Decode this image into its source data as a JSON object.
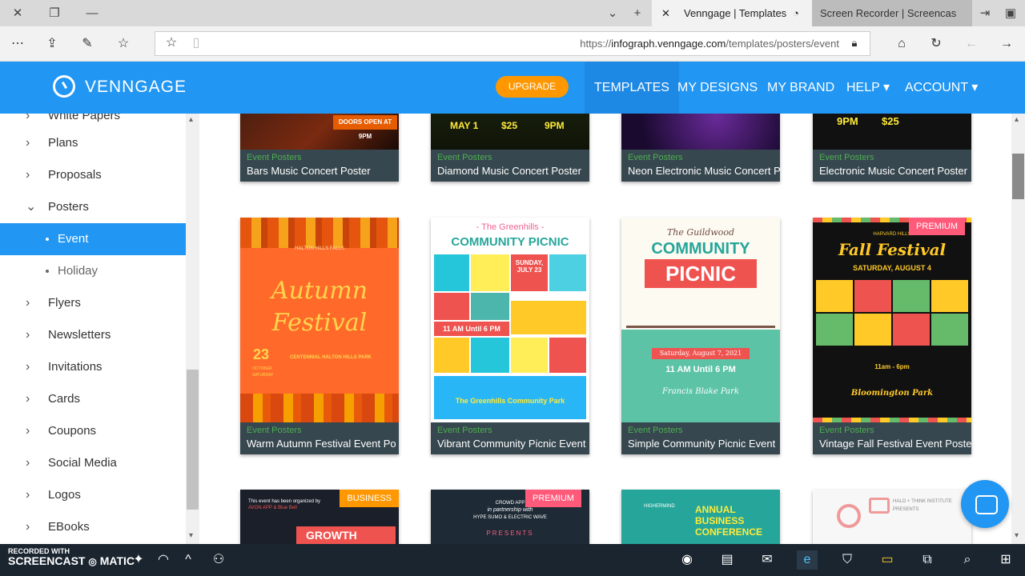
{
  "browser": {
    "tabs": [
      {
        "title": "Venngage | Templates",
        "active": true
      },
      {
        "title": "Screen Recorder | Screencas",
        "active": false
      }
    ],
    "url": "https://infograph.venngage.com/templates/posters/event",
    "url_prefix": "https://",
    "url_host": "infograph.venngage.com",
    "url_path": "/templates/posters/event"
  },
  "header": {
    "logo": "VENNGAGE",
    "upgrade": "UPGRADE",
    "nav": [
      "TEMPLATES",
      "MY DESIGNS",
      "MY BRAND",
      "HELP ▾",
      "ACCOUNT ▾"
    ]
  },
  "sidebar": {
    "items": [
      {
        "label": "White Papers",
        "type": "cat"
      },
      {
        "label": "Plans",
        "type": "cat"
      },
      {
        "label": "Proposals",
        "type": "cat"
      },
      {
        "label": "Posters",
        "type": "cat-open"
      },
      {
        "label": "Event",
        "type": "sub-selected"
      },
      {
        "label": "Holiday",
        "type": "sub"
      },
      {
        "label": "Flyers",
        "type": "cat"
      },
      {
        "label": "Newsletters",
        "type": "cat"
      },
      {
        "label": "Invitations",
        "type": "cat"
      },
      {
        "label": "Cards",
        "type": "cat"
      },
      {
        "label": "Coupons",
        "type": "cat"
      },
      {
        "label": "Social Media",
        "type": "cat"
      },
      {
        "label": "Logos",
        "type": "cat"
      },
      {
        "label": "EBooks",
        "type": "cat"
      }
    ]
  },
  "cards_row1": [
    {
      "category": "Event Posters",
      "title": "Bars Music Concert Poster",
      "art": [
        "DOORS OPEN AT 9PM"
      ]
    },
    {
      "category": "Event Posters",
      "title": "Diamond Music Concert Poster",
      "art": [
        "MAY 1",
        "$25",
        "9PM"
      ]
    },
    {
      "category": "Event Posters",
      "title": "Neon Electronic Music Concert P",
      "art": []
    },
    {
      "category": "Event Posters",
      "title": "Electronic Music Concert Poster",
      "art": [
        "9PM",
        "$25"
      ]
    }
  ],
  "cards_row2": [
    {
      "category": "Event Posters",
      "title": "Warm Autumn Festival Event Po",
      "badge": "",
      "art": [
        "HALTON HILLS FALLS",
        "Autumn",
        "Festival",
        "23",
        "OCTOBER",
        "SATURDAY",
        "CENTENNIAL HALTON HILLS PARK"
      ]
    },
    {
      "category": "Event Posters",
      "title": "Vibrant Community Picnic Event",
      "badge": "",
      "art": [
        "- The Greenhills -",
        "COMMUNITY PICNIC",
        "SUNDAY,",
        "JULY 23",
        "11 AM Until 6 PM",
        "The Greenhills Community Park"
      ]
    },
    {
      "category": "Event Posters",
      "title": "Simple Community Picnic Event",
      "badge": "",
      "art": [
        "The Guildwood",
        "COMMUNITY",
        "PICNIC",
        "Saturday, August 7, 2021",
        "11 AM Until 6 PM",
        "Francis Blake Park"
      ]
    },
    {
      "category": "Event Posters",
      "title": "Vintage Fall Festival Event Poste",
      "badge": "PREMIUM",
      "art": [
        "HARVARD HILLS",
        "Fall Festival",
        "SATURDAY, AUGUST 4",
        "11am - 6pm",
        "Bloomington Park"
      ]
    }
  ],
  "cards_row3": [
    {
      "badge": "BUSINESS",
      "art": [
        "This event has been organized by",
        "AVON APP & Blue Bell",
        "GROWTH"
      ]
    },
    {
      "badge": "PREMIUM",
      "art": [
        "CROWD APP",
        "in partnership with",
        "HYPE SUMO & ELECTRIC WAVE",
        "PRESENTS"
      ]
    },
    {
      "badge": "",
      "art": [
        "HIGHERMIND",
        "ANNUAL",
        "BUSINESS",
        "CONFERENCE"
      ]
    },
    {
      "badge": "",
      "art": [
        "HALO + THINK INSTITUTE",
        "PRESENTS"
      ]
    }
  ],
  "watermark": {
    "line1": "RECORDED WITH",
    "line2": "SCREENCAST",
    "line3": "MATIC"
  },
  "colors": {
    "brand": "#2196f3",
    "upgrade": "#ff9800",
    "premium": "#ff5a7a",
    "business": "#ff9800"
  }
}
